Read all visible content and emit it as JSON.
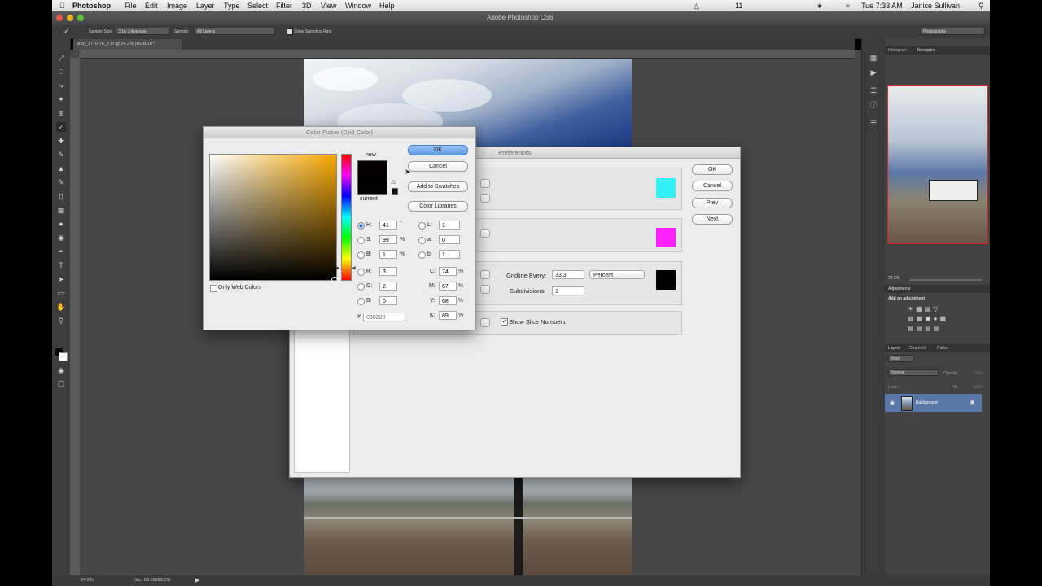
{
  "menubar": {
    "app": "Photoshop",
    "items": [
      "File",
      "Edit",
      "Image",
      "Layer",
      "Type",
      "Select",
      "Filter",
      "3D",
      "View",
      "Window",
      "Help"
    ],
    "clock": "Tue 7:33 AM",
    "user": "Janice Sullivan",
    "battery_level": "11"
  },
  "window_title": "Adobe Photoshop CS6",
  "options": {
    "sample_size_label": "Sample Size:",
    "sample_size_value": "3 by 3 Average",
    "sample_label": "Sample:",
    "sample_value": "All Layers",
    "sampling_ring": "Show Sampling Ring",
    "workspace": "Photography"
  },
  "doc_tab": "arco_1770-76_2.tif @ 24.2% (RGB/16*)",
  "status": {
    "zoom": "24.2%",
    "doc": "Doc: 69.1M/69.1M"
  },
  "panels": {
    "navigator_tabs": [
      "Histogram",
      "Navigator"
    ],
    "navigator_zoom": "24.2%",
    "adjustments_title": "Adjustments",
    "add_adjustment": "Add an adjustment",
    "layers_tabs": [
      "Layers",
      "Channels",
      "Paths"
    ],
    "kind": "Kind",
    "blend_mode": "Normal",
    "opacity_label": "Opacity:",
    "opacity_value": "100%",
    "lock_label": "Lock:",
    "fill_label": "Fill:",
    "fill_value": "100%",
    "layer_name": "Background"
  },
  "preferences": {
    "title": "Preferences",
    "buttons": {
      "ok": "OK",
      "cancel": "Cancel",
      "prev": "Prev",
      "next": "Next"
    },
    "guide_color": "#33f0f5",
    "smart_guide_color": "#ff22ff",
    "grid_color": "#000000",
    "gridline_label": "Gridline Every:",
    "gridline_value": "33.3",
    "gridline_unit": "Percent",
    "subdivisions_label": "Subdivisions:",
    "subdivisions_value": "1",
    "show_slice_numbers": "Show Slice Numbers"
  },
  "color_picker": {
    "title": "Color Picker (Grid Color)",
    "new_label": "new",
    "current_label": "current",
    "new_color": "#030200",
    "current_color": "#000000",
    "buttons": {
      "ok": "OK",
      "cancel": "Cancel",
      "add_swatches": "Add to Swatches",
      "libraries": "Color Libraries"
    },
    "only_web": "Only Web Colors",
    "H": {
      "label": "H:",
      "value": "41",
      "unit": "°"
    },
    "S": {
      "label": "S:",
      "value": "99",
      "unit": "%"
    },
    "B": {
      "label": "B:",
      "value": "1",
      "unit": "%"
    },
    "R": {
      "label": "R:",
      "value": "3"
    },
    "G": {
      "label": "G:",
      "value": "2"
    },
    "Bb": {
      "label": "B:",
      "value": "0"
    },
    "L": {
      "label": "L:",
      "value": "1"
    },
    "a": {
      "label": "a:",
      "value": "0"
    },
    "b": {
      "label": "b:",
      "value": "1"
    },
    "C": {
      "label": "C:",
      "value": "74",
      "unit": "%"
    },
    "M": {
      "label": "M:",
      "value": "67",
      "unit": "%"
    },
    "Y": {
      "label": "Y:",
      "value": "68",
      "unit": "%"
    },
    "K": {
      "label": "K:",
      "value": "89",
      "unit": "%"
    },
    "hex_label": "#",
    "hex": "030200"
  }
}
